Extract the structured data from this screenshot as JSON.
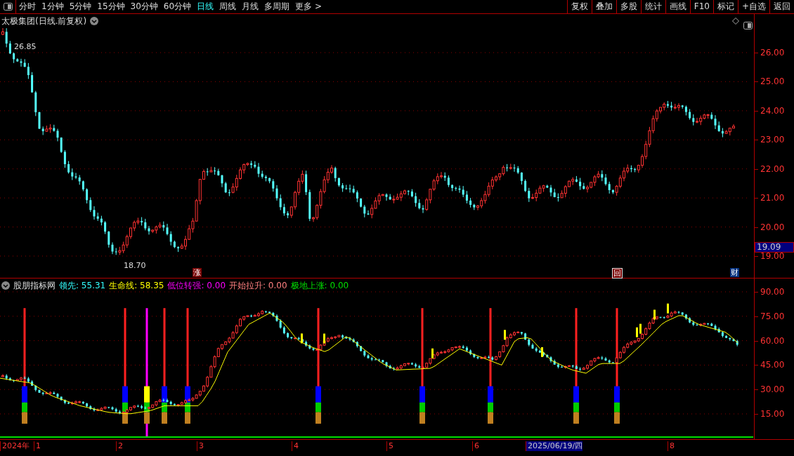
{
  "toolbar": {
    "periods": [
      {
        "label": "分时",
        "selected": false
      },
      {
        "label": "1分钟",
        "selected": false
      },
      {
        "label": "5分钟",
        "selected": false
      },
      {
        "label": "15分钟",
        "selected": false
      },
      {
        "label": "30分钟",
        "selected": false
      },
      {
        "label": "60分钟",
        "selected": false
      },
      {
        "label": "日线",
        "selected": true
      },
      {
        "label": "周线",
        "selected": false
      },
      {
        "label": "月线",
        "selected": false
      },
      {
        "label": "多周期",
        "selected": false
      },
      {
        "label": "更多 >",
        "selected": false
      }
    ],
    "buttons": [
      "复权",
      "叠加",
      "多股",
      "统计",
      "画线",
      "F10",
      "标记",
      "+自选",
      "返回"
    ]
  },
  "price_chart": {
    "title": "太极集团(日线.前复权)",
    "high_label": "26.85",
    "low_label": "18.70",
    "yticks": [
      "26.00",
      "25.00",
      "24.00",
      "23.00",
      "22.00",
      "21.00",
      "20.00",
      "19.00"
    ],
    "current_price": "19.09",
    "markers": [
      "涨",
      "回",
      "财"
    ]
  },
  "indicator": {
    "name": "股朋指标网",
    "values": [
      {
        "text": "领先: 55.31",
        "color": "#33ffff"
      },
      {
        "text": "生命线: 58.35",
        "color": "#ffff00"
      },
      {
        "text": "低位转强: 0.00",
        "color": "#ff00ff"
      },
      {
        "text": "开始拉升: 0.00",
        "color": "#ff8080"
      },
      {
        "text": "极地上涨: 0.00",
        "color": "#00e000"
      }
    ],
    "yticks": [
      "90.00",
      "75.00",
      "60.00",
      "45.00",
      "30.00",
      "15.00"
    ]
  },
  "date_axis": {
    "labels": [
      {
        "text": "2024年",
        "selected": false
      },
      {
        "text": "1",
        "selected": false
      },
      {
        "text": "2",
        "selected": false
      },
      {
        "text": "3",
        "selected": false
      },
      {
        "text": "4",
        "selected": false
      },
      {
        "text": "5",
        "selected": false
      },
      {
        "text": "6",
        "selected": false
      },
      {
        "text": "2025/06/19/四",
        "selected": true
      },
      {
        "text": "8",
        "selected": false
      }
    ]
  }
}
